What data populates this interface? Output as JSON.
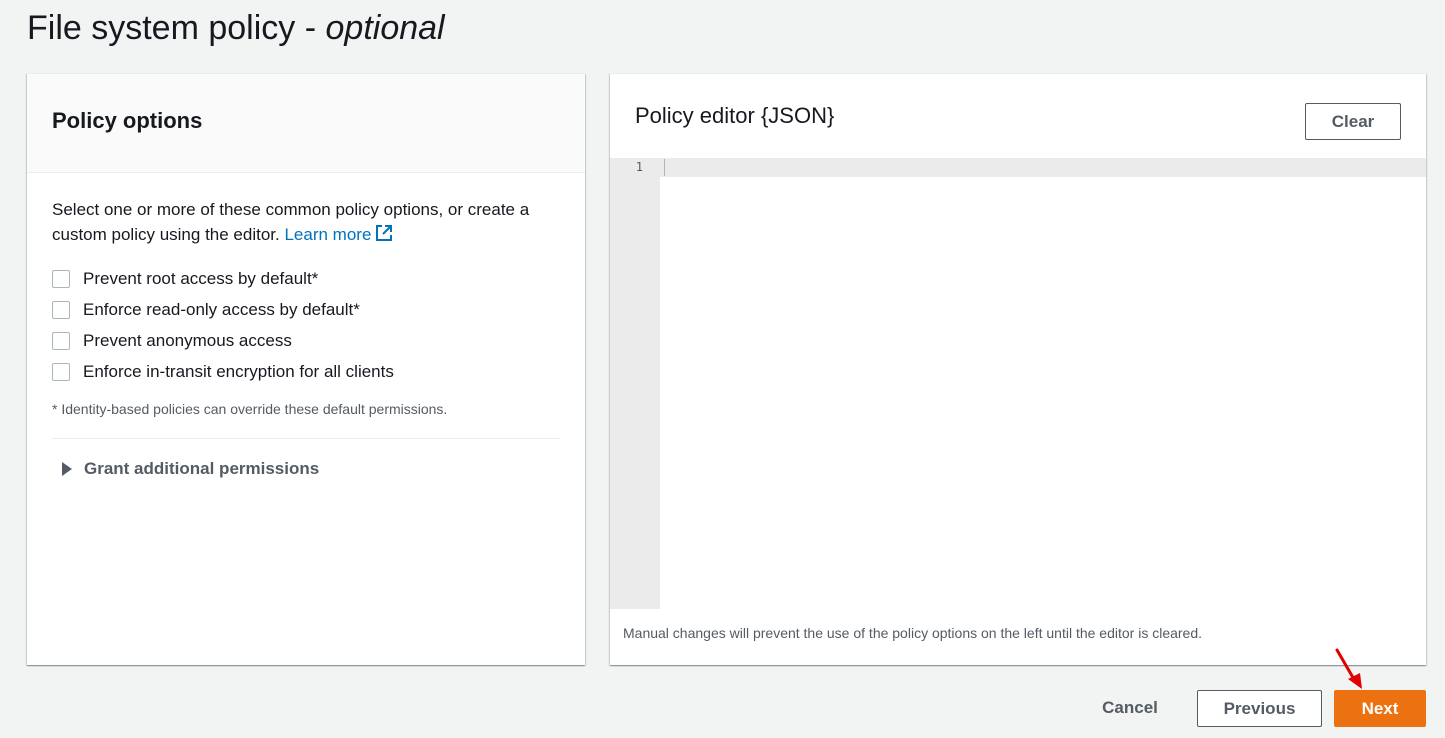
{
  "page": {
    "title_main": "File system policy - ",
    "title_optional": "optional"
  },
  "policy_options": {
    "heading": "Policy options",
    "description": "Select one or more of these common policy options, or create a custom policy using the editor. ",
    "learn_more": "Learn more",
    "options": [
      {
        "label": "Prevent root access by default*",
        "checked": false
      },
      {
        "label": "Enforce read-only access by default*",
        "checked": false
      },
      {
        "label": "Prevent anonymous access",
        "checked": false
      },
      {
        "label": "Enforce in-transit encryption for all clients",
        "checked": false
      }
    ],
    "footnote": "* Identity-based policies can override these default permissions.",
    "expander_label": "Grant additional permissions"
  },
  "policy_editor": {
    "heading": "Policy editor {JSON}",
    "clear_label": "Clear",
    "line_numbers": [
      "1"
    ],
    "note": "Manual changes will prevent the use of the policy options on the left until the editor is cleared."
  },
  "footer": {
    "cancel_label": "Cancel",
    "previous_label": "Previous",
    "next_label": "Next"
  },
  "colors": {
    "accent": "#ec7211",
    "link": "#0073bb",
    "annotation_arrow": "#e00000"
  }
}
